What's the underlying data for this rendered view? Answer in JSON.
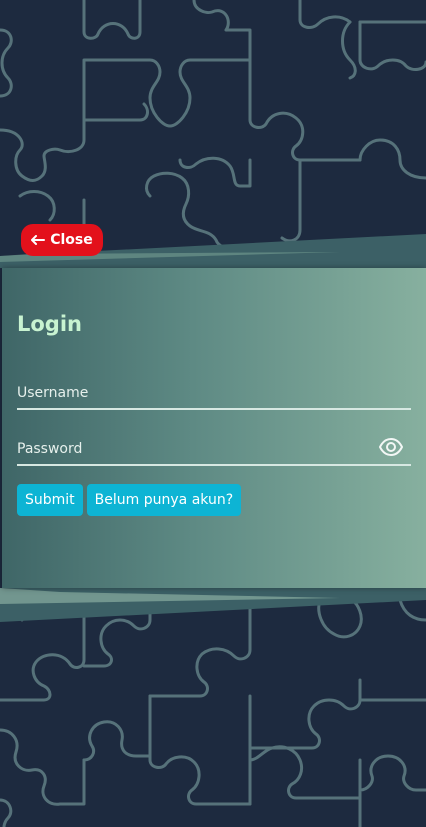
{
  "close_button": {
    "label": "Close",
    "icon": "arrow-left-icon",
    "color": "#e3111b"
  },
  "login": {
    "title": "Login",
    "username_placeholder": "Username",
    "password_placeholder": "Password",
    "password_toggle_icon": "eye-icon",
    "submit_label": "Submit",
    "register_label": "Belum punya akun?"
  },
  "colors": {
    "background": "#1d2a3f",
    "pattern_stroke": "#4d6a74",
    "title": "#c8f3d1",
    "button": "#0db4d4"
  }
}
